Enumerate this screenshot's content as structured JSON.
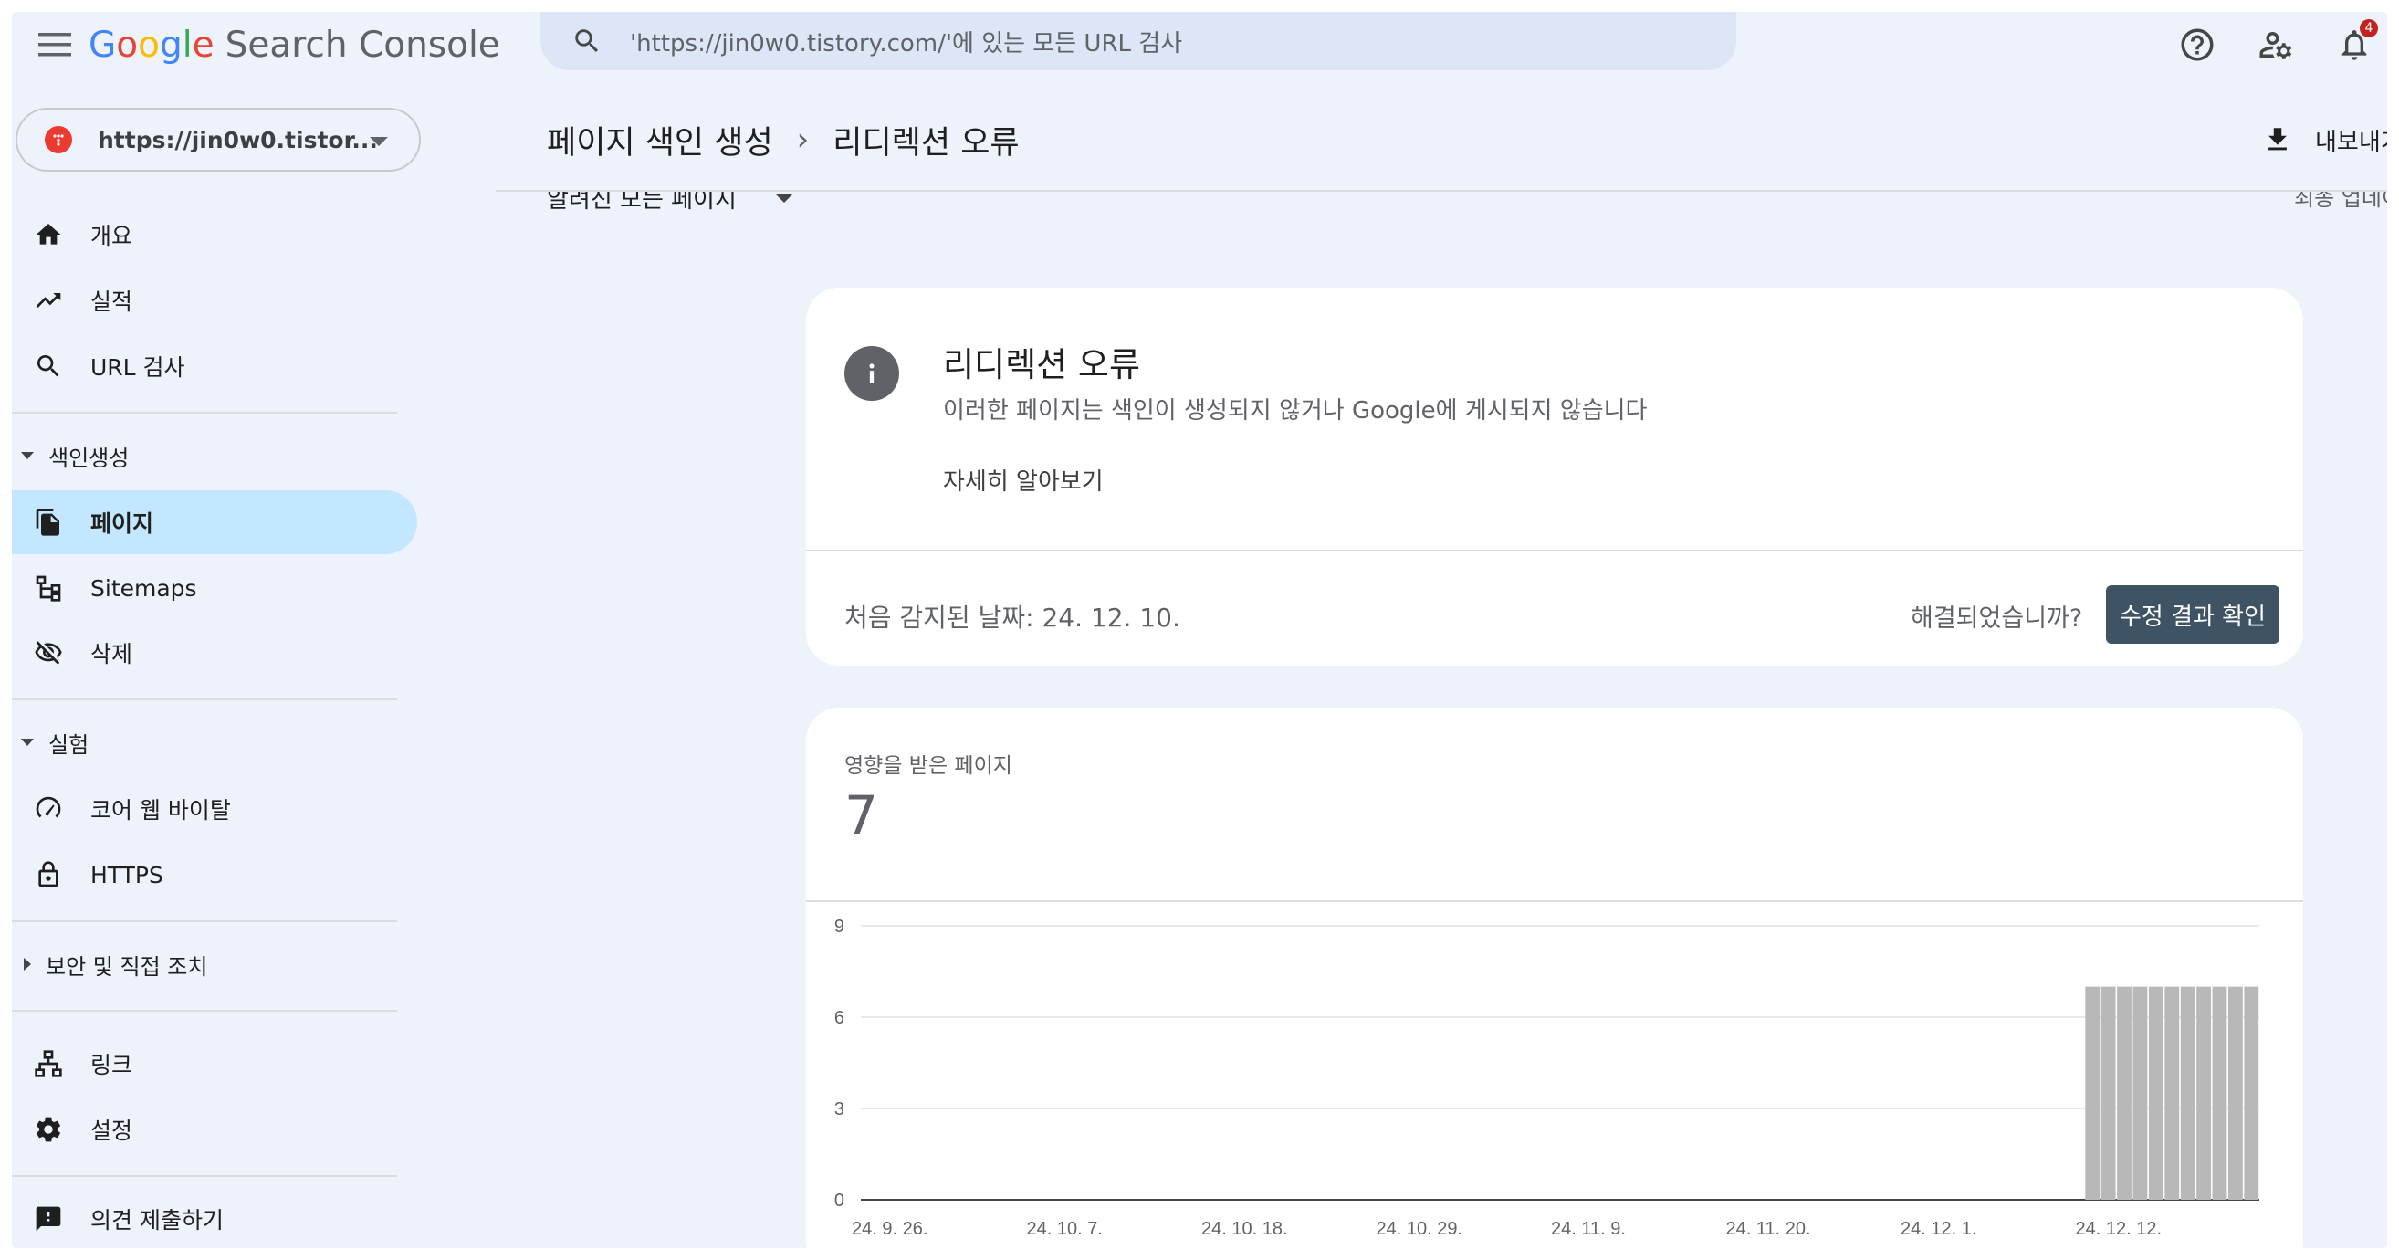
{
  "header": {
    "logo_google": [
      "G",
      "o",
      "o",
      "g",
      "l",
      "e"
    ],
    "logo_product": "Search Console",
    "search_placeholder": "'https://jin0w0.tistory.com/'에 있는 모든 URL 검사",
    "notification_count": "4",
    "icons": [
      "menu-icon",
      "search-icon",
      "help-icon",
      "manage-accounts-icon",
      "notifications-icon"
    ]
  },
  "property": {
    "url": "https://jin0w0.tistor...",
    "favicon_color": "#eb3a32"
  },
  "sidebar": {
    "overview": "개요",
    "performance": "실적",
    "url_inspection": "URL 검사",
    "indexing_section": "색인생성",
    "pages": "페이지",
    "sitemaps": "Sitemaps",
    "removals": "삭제",
    "experience_section": "실험",
    "core_web_vitals": "코어 웹 바이탈",
    "https": "HTTPS",
    "security_section": "보안 및 직접 조치",
    "links": "링크",
    "settings": "설정",
    "feedback": "의견 제출하기",
    "active_bg": "#c2e7ff"
  },
  "page": {
    "breadcrumb_parent": "페이지 색인 생성",
    "breadcrumb_current": "리디렉션 오류",
    "export_label": "내보내기",
    "filter_label": "알려진 모든 페이지",
    "updated_label": "최종 업데이트"
  },
  "issue": {
    "title": "리디렉션 오류",
    "description": "이러한 페이지는 색인이 생성되지 않거나 Google에 게시되지 않습니다",
    "learn_more": "자세히 알아보기",
    "first_detected": "처음 감지된 날짜: 24. 12. 10.",
    "resolved_question": "해결되었습니까?",
    "validate_button": "수정 결과 확인",
    "button_color": "#3e5363"
  },
  "affected": {
    "label": "영향을 받은 페이지",
    "value": "7"
  },
  "chart_data": {
    "type": "bar",
    "ylim": [
      0,
      9
    ],
    "yticks": [
      "0",
      "3",
      "6",
      "9"
    ],
    "x_tick_labels": [
      "24. 9. 26.",
      "24. 10. 7.",
      "24. 10. 18.",
      "24. 10. 29.",
      "24. 11. 9.",
      "24. 11. 20.",
      "24. 12. 1.",
      "24. 12. 12."
    ],
    "x_range": [
      "2024-09-26",
      "2024-12-23"
    ],
    "bars": [
      {
        "date": "2024-12-12",
        "value": 7
      },
      {
        "date": "2024-12-13",
        "value": 7
      },
      {
        "date": "2024-12-14",
        "value": 7
      },
      {
        "date": "2024-12-15",
        "value": 7
      },
      {
        "date": "2024-12-16",
        "value": 7
      },
      {
        "date": "2024-12-17",
        "value": 7
      },
      {
        "date": "2024-12-18",
        "value": 7
      },
      {
        "date": "2024-12-19",
        "value": 7
      },
      {
        "date": "2024-12-20",
        "value": 7
      },
      {
        "date": "2024-12-21",
        "value": 7
      },
      {
        "date": "2024-12-22",
        "value": 7
      }
    ],
    "bar_color": "#b8b8b8",
    "grid": true
  }
}
